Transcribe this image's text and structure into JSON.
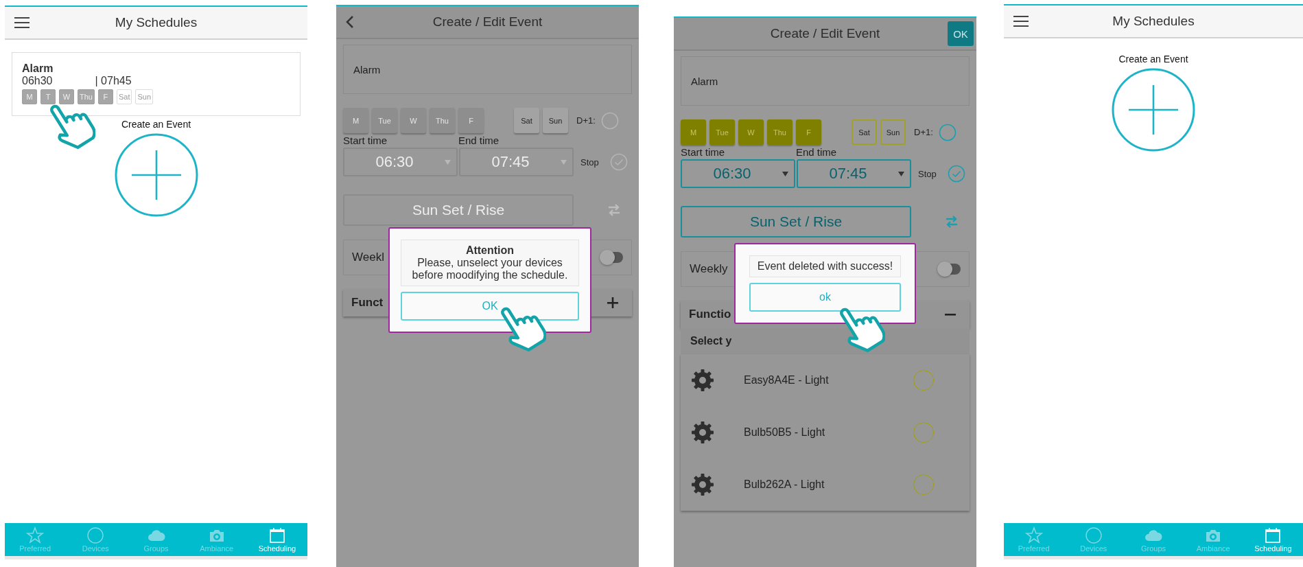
{
  "screens": [
    {
      "kind": "list",
      "header": {
        "title": "My Schedules"
      },
      "events": [
        {
          "name": "Alarm",
          "start": "06h30",
          "end": "| 07h45",
          "days": [
            {
              "label": "M",
              "selected": true
            },
            {
              "label": "T",
              "selected": true
            },
            {
              "label": "W",
              "selected": true
            },
            {
              "label": "Thu",
              "selected": true
            },
            {
              "label": "F",
              "selected": true
            },
            {
              "label": "Sat",
              "selected": false
            },
            {
              "label": "Sun",
              "selected": false
            }
          ]
        }
      ],
      "create_label": "Create an Event",
      "nav": [
        {
          "label": "Preferred",
          "selected": false
        },
        {
          "label": "Devices",
          "selected": false
        },
        {
          "label": "Groups",
          "selected": false
        },
        {
          "label": "Ambiance",
          "selected": false
        },
        {
          "label": "Scheduling",
          "selected": true
        }
      ]
    },
    {
      "kind": "editor",
      "header": {
        "back": true,
        "title": "Create / Edit Event"
      },
      "editable": false,
      "name": "Alarm",
      "days": [
        {
          "label": "M",
          "selected": true
        },
        {
          "label": "Tue",
          "selected": true
        },
        {
          "label": "W",
          "selected": true
        },
        {
          "label": "Thu",
          "selected": true
        },
        {
          "label": "F",
          "selected": true
        },
        {
          "label": "Sat",
          "selected": false
        },
        {
          "label": "Sun",
          "selected": false
        }
      ],
      "d_plus_1": {
        "label": "D+1:",
        "checked": false
      },
      "start_label": "Start time",
      "end_label": "End time",
      "start": "06:30",
      "end": "07:45",
      "stop": {
        "label": "Stop",
        "checked": true
      },
      "sun_button": "Sun Set / Rise",
      "weekly": {
        "label": "Weekl",
        "on": false
      },
      "function": {
        "label": "Funct",
        "expanded": false
      },
      "dialog": {
        "title": "Attention",
        "message": "Please, unselect your devices before moodifying the schedule.",
        "button": "OK"
      }
    },
    {
      "kind": "editor",
      "header": {
        "title": "Create / Edit Event",
        "action": "OK"
      },
      "editable": true,
      "name": "Alarm",
      "days": [
        {
          "label": "M",
          "selected": true
        },
        {
          "label": "Tue",
          "selected": true
        },
        {
          "label": "W",
          "selected": true
        },
        {
          "label": "Thu",
          "selected": true
        },
        {
          "label": "F",
          "selected": true
        },
        {
          "label": "Sat",
          "selected": false
        },
        {
          "label": "Sun",
          "selected": false
        }
      ],
      "d_plus_1": {
        "label": "D+1:",
        "checked": false
      },
      "start_label": "Start time",
      "end_label": "End time",
      "start": "06:30",
      "end": "07:45",
      "stop": {
        "label": "Stop",
        "checked": true
      },
      "sun_button": "Sun Set / Rise",
      "weekly": {
        "label": "Weekly",
        "on": false
      },
      "function": {
        "label": "Functio",
        "expanded": true
      },
      "devices": {
        "title": "Select y",
        "items": [
          {
            "name": "Easy8A4E - Light",
            "selected": false
          },
          {
            "name": "Bulb50B5 - Light",
            "selected": false
          },
          {
            "name": "Bulb262A - Light",
            "selected": false
          }
        ]
      },
      "dialog": {
        "message": "Event deleted with success!",
        "button": "ok"
      }
    },
    {
      "kind": "list",
      "header": {
        "title": "My Schedules"
      },
      "create_label": "Create an Event",
      "nav": [
        {
          "label": "Preferred",
          "selected": false
        },
        {
          "label": "Devices",
          "selected": false
        },
        {
          "label": "Groups",
          "selected": false
        },
        {
          "label": "Ambiance",
          "selected": false
        },
        {
          "label": "Scheduling",
          "selected": true
        }
      ]
    }
  ]
}
